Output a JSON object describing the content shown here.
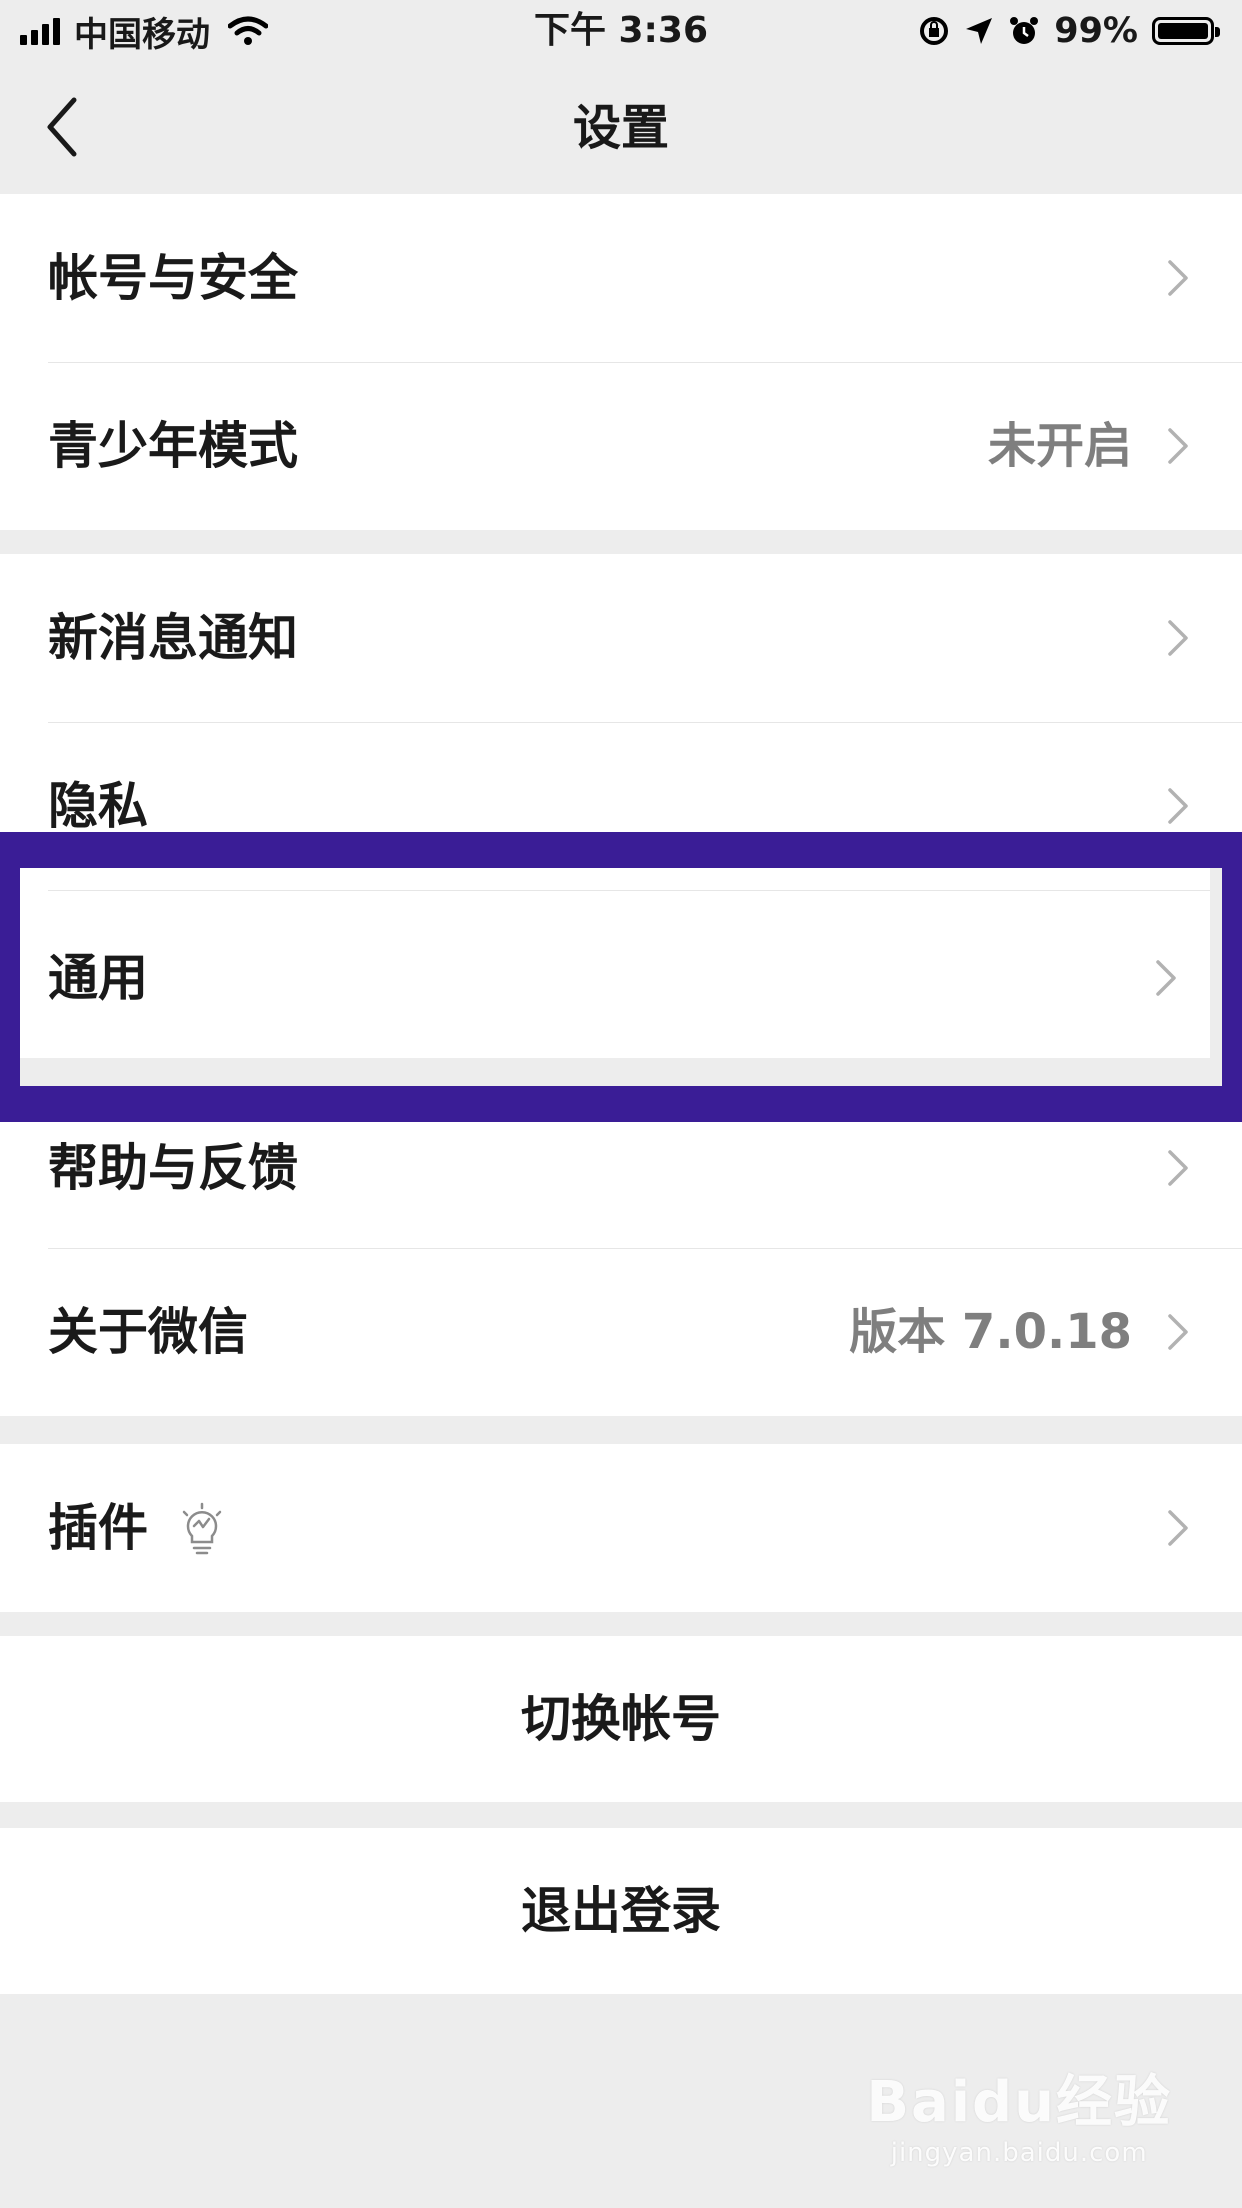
{
  "status_bar": {
    "carrier": "中国移动",
    "time": "下午 3:36",
    "battery_percent": "99%",
    "battery_level": 0.99,
    "icons": [
      "signal-icon",
      "wifi-icon",
      "rotation-lock-icon",
      "location-icon",
      "alarm-icon",
      "battery-icon"
    ]
  },
  "nav": {
    "title": "设置",
    "back_icon": "chevron-left-icon"
  },
  "groups": [
    {
      "items": [
        {
          "label": "帐号与安全",
          "value": ""
        },
        {
          "label": "青少年模式",
          "value": "未开启"
        }
      ]
    },
    {
      "items": [
        {
          "label": "新消息通知",
          "value": ""
        },
        {
          "label": "隐私",
          "value": ""
        },
        {
          "label": "通用",
          "value": "",
          "highlighted": true
        }
      ]
    },
    {
      "items": [
        {
          "label": "帮助与反馈",
          "value": ""
        },
        {
          "label": "关于微信",
          "value": "版本 7.0.18"
        }
      ]
    },
    {
      "items": [
        {
          "label": "插件",
          "value": "",
          "icon": "lightbulb-icon"
        }
      ]
    }
  ],
  "actions": {
    "switch_account": "切换帐号",
    "logout": "退出登录"
  },
  "watermark": {
    "logo": "Baidu经验",
    "url": "jingyan.baidu.com"
  },
  "colors": {
    "background": "#ededed",
    "row_background": "#ffffff",
    "highlight_border": "#3a1d96",
    "secondary_text": "#7f7f7f"
  }
}
